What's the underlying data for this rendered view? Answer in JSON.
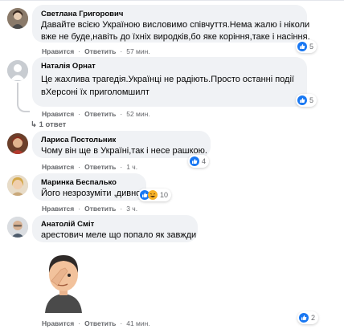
{
  "comments": [
    {
      "author": "Светлана Григорович",
      "lines": [
        "Давайте всією Україною висловимо співчуття.Нема жалю і ніколи",
        "вже не буде,навіть до їхніх виродків,бо яке коріння,таке і насіння."
      ],
      "like": "Нравится",
      "reply": "Ответить",
      "time": "57 мин.",
      "reactions": "5"
    },
    {
      "author": "Наталія Орнат",
      "lines": [
        "Це жахлива трагедія.Українці не радіють.Просто останні події",
        "вХерсоні їх приголомшилт"
      ],
      "like": "Нравится",
      "reply": "Ответить",
      "time": "52 мин.",
      "reactions": "5",
      "replies": "1 ответ"
    },
    {
      "author": "Лариса Постольник",
      "lines": [
        "Чому він ще в Україні,так і несе рашкою."
      ],
      "like": "Нравится",
      "reply": "Ответить",
      "time": "1 ч.",
      "reactions": "4"
    },
    {
      "author": "Маринка Беспалько",
      "lines": [
        "Його незрозуміти ,дивно"
      ],
      "like": "Нравится",
      "reply": "Ответить",
      "time": "3 ч.",
      "reactions": "10"
    },
    {
      "author": "Анатолій Сміт",
      "lines": [
        "арестович меле що попало як завжди"
      ],
      "like": "Нравится",
      "reply": "Ответить",
      "time": "41 мин.",
      "reactions": "2"
    }
  ],
  "colors": {
    "like_blue": "#1877f2",
    "haha_yellow": "#f7b125",
    "bubble_bg": "#f0f2f5",
    "meta_gray": "#65676b"
  },
  "icons": {
    "like": "like-icon",
    "haha": "haha-icon",
    "avatar_placeholder": "default-avatar-icon",
    "sticker": "facepalm-sticker"
  }
}
